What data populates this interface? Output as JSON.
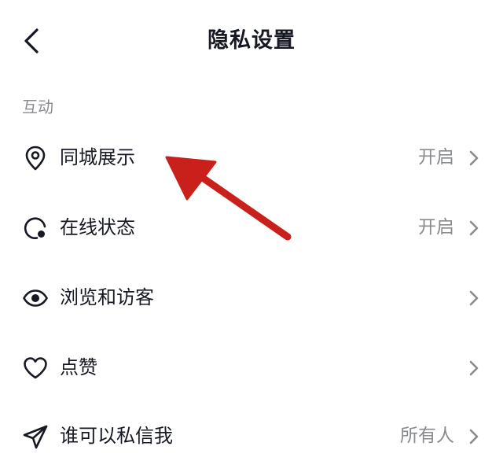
{
  "header": {
    "title": "隐私设置",
    "back_icon": "chevron-left-icon"
  },
  "section": {
    "title": "互动"
  },
  "rows": [
    {
      "label": "同城展示",
      "value": "开启",
      "icon": "location-pin-icon"
    },
    {
      "label": "在线状态",
      "value": "开启",
      "icon": "online-status-icon"
    },
    {
      "label": "浏览和访客",
      "value": "",
      "icon": "eye-icon"
    },
    {
      "label": "点赞",
      "value": "",
      "icon": "heart-icon"
    },
    {
      "label": "谁可以私信我",
      "value": "所有人",
      "icon": "send-icon"
    }
  ],
  "colors": {
    "text": "#161823",
    "secondary": "#8a8b91",
    "annotation_arrow": "#c9201c"
  }
}
